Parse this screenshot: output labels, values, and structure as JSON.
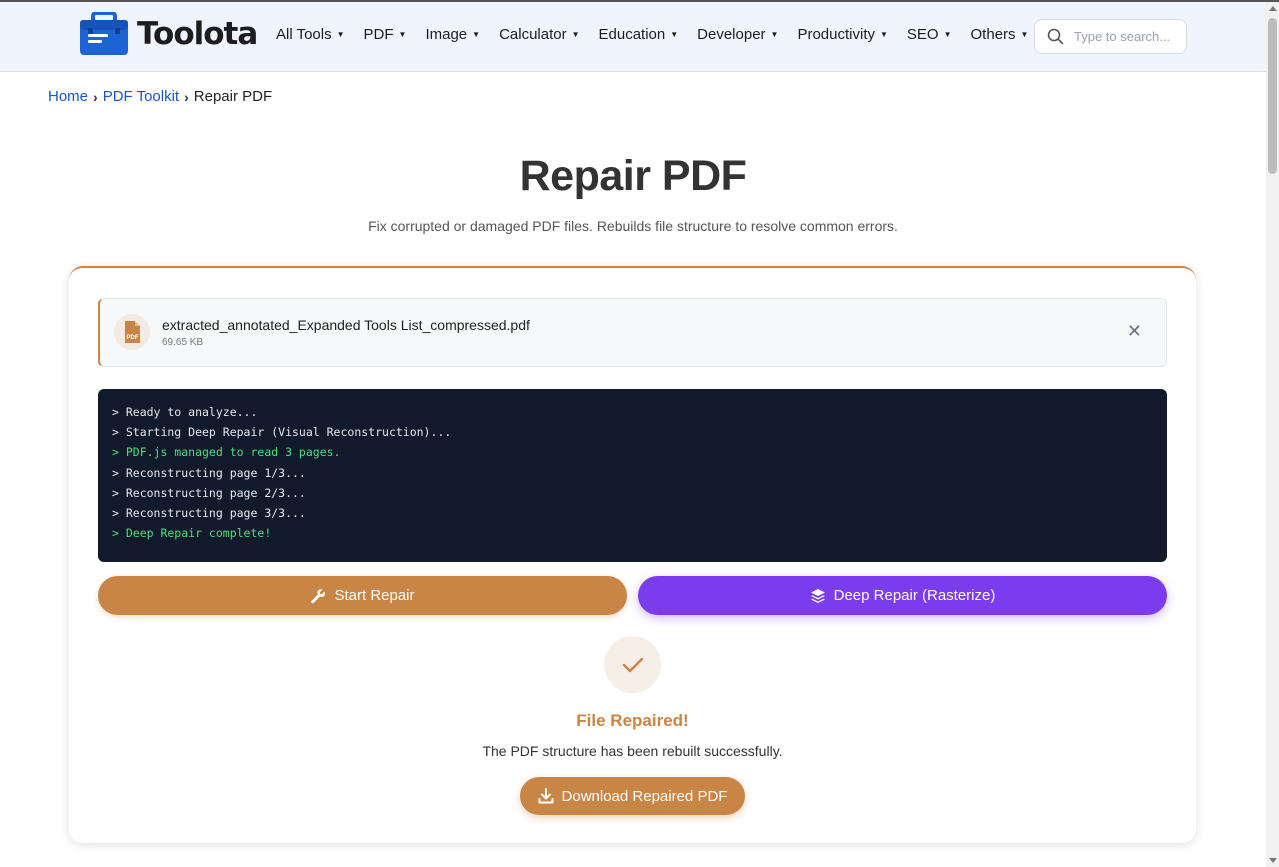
{
  "brand": {
    "name": "Toolota"
  },
  "nav": {
    "items": [
      {
        "label": "All Tools"
      },
      {
        "label": "PDF"
      },
      {
        "label": "Image"
      },
      {
        "label": "Calculator"
      },
      {
        "label": "Education"
      },
      {
        "label": "Developer"
      },
      {
        "label": "Productivity"
      },
      {
        "label": "SEO"
      },
      {
        "label": "Others"
      }
    ],
    "search_placeholder": "Type to search..."
  },
  "breadcrumb": {
    "home": "Home",
    "section": "PDF Toolkit",
    "current": "Repair PDF"
  },
  "page": {
    "title": "Repair PDF",
    "subtitle": "Fix corrupted or damaged PDF files. Rebuilds file structure to resolve common errors."
  },
  "file": {
    "name": "extracted_annotated_Expanded Tools List_compressed.pdf",
    "size": "69.65 KB",
    "icon_label": "PDF",
    "close_glyph": "✕"
  },
  "console": {
    "lines": [
      {
        "text": "> Ready to analyze...",
        "status": "normal"
      },
      {
        "text": "> Starting Deep Repair (Visual Reconstruction)...",
        "status": "normal"
      },
      {
        "text": "> PDF.js managed to read 3 pages.",
        "status": "ok"
      },
      {
        "text": "> Reconstructing page 1/3...",
        "status": "normal"
      },
      {
        "text": "> Reconstructing page 2/3...",
        "status": "normal"
      },
      {
        "text": "> Reconstructing page 3/3...",
        "status": "normal"
      },
      {
        "text": "> Deep Repair complete!",
        "status": "ok"
      }
    ]
  },
  "actions": {
    "start_label": "Start Repair",
    "deep_label": "Deep Repair (Rasterize)"
  },
  "result": {
    "title": "File Repaired!",
    "message": "The PDF structure has been rebuilt successfully.",
    "download_label": "Download Repaired PDF"
  },
  "colors": {
    "accent": "#c98546",
    "purple": "#7a3cec",
    "link": "#1a56c4",
    "console_bg": "#111a2b",
    "console_ok": "#4ade80",
    "logo_blue": "#1e63d6"
  },
  "icons": {
    "logo": "toolbox-icon",
    "search": "search-icon",
    "file": "pdf-file-icon",
    "start": "wrench-icon",
    "deep": "layers-icon",
    "success": "check-icon",
    "download": "download-icon"
  }
}
